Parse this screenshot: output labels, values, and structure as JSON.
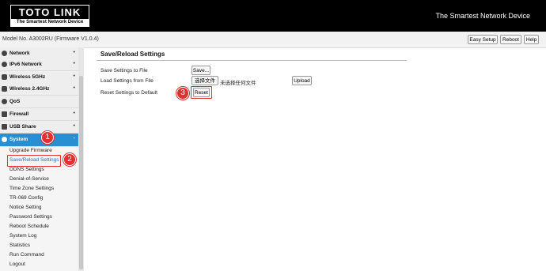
{
  "header": {
    "logo_main": "TOTO LINK",
    "logo_sub": "The Smartest Network Device",
    "tagline": "The Smartest Network Device"
  },
  "topbar": {
    "model": "Model No. A3002RU (Firmware V1.0.4)",
    "easy_setup": "Easy Setup",
    "reboot": "Reboot",
    "help": "Help"
  },
  "sidebar": {
    "items": [
      {
        "label": "Network",
        "bullet": "•"
      },
      {
        "label": "IPv6 Network",
        "bullet": "•"
      },
      {
        "label": "Wireless 5GHz",
        "bullet": "•"
      },
      {
        "label": "Wireless 2.4GHz",
        "bullet": "•"
      },
      {
        "label": "QoS",
        "bullet": ""
      },
      {
        "label": "Firewall",
        "bullet": "•"
      },
      {
        "label": "USB Share",
        "bullet": "•"
      },
      {
        "label": "System",
        "bullet": "-"
      }
    ],
    "subitems": [
      "Upgrade Firmware",
      "Save/Reload Settings",
      "DDNS Settings",
      "Denial-of-Service",
      "Time Zone Settings",
      "TR-069 Config",
      "Notice Setting",
      "Password Settings",
      "Reboot Schedule",
      "System Log",
      "Statistics",
      "Run Command",
      "Logout"
    ]
  },
  "main": {
    "title": "Save/Reload Settings",
    "rows": {
      "save_label": "Save Settings to File",
      "save_btn": "Save...",
      "load_label": "Load Settings from File",
      "choose_file_btn": "选择文件",
      "no_file": "未选择任何文件",
      "upload_btn": "Upload",
      "reset_label": "Reset Settings to Default",
      "reset_btn": "Reset"
    }
  },
  "annotations": {
    "step1": "1",
    "step2": "2",
    "step3": "3"
  },
  "colors": {
    "accent": "#2a8fd0",
    "annotation": "#e03030",
    "header_bg": "#000000"
  }
}
